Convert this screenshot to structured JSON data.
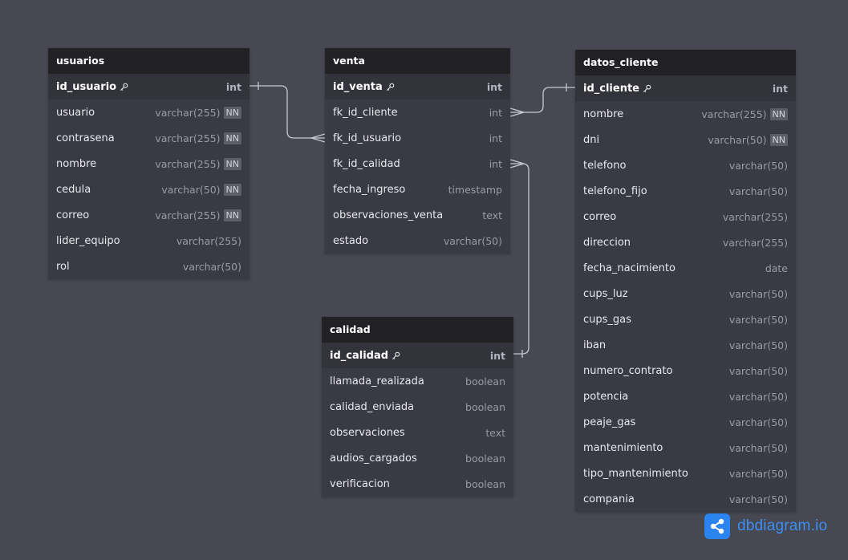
{
  "tables": {
    "usuarios": {
      "name": "usuarios",
      "fields": [
        {
          "name": "id_usuario",
          "type": "int",
          "pk": true,
          "nn": false
        },
        {
          "name": "usuario",
          "type": "varchar(255)",
          "pk": false,
          "nn": true
        },
        {
          "name": "contrasena",
          "type": "varchar(255)",
          "pk": false,
          "nn": true
        },
        {
          "name": "nombre",
          "type": "varchar(255)",
          "pk": false,
          "nn": true
        },
        {
          "name": "cedula",
          "type": "varchar(50)",
          "pk": false,
          "nn": true
        },
        {
          "name": "correo",
          "type": "varchar(255)",
          "pk": false,
          "nn": true
        },
        {
          "name": "lider_equipo",
          "type": "varchar(255)",
          "pk": false,
          "nn": false
        },
        {
          "name": "rol",
          "type": "varchar(50)",
          "pk": false,
          "nn": false
        }
      ]
    },
    "venta": {
      "name": "venta",
      "fields": [
        {
          "name": "id_venta",
          "type": "int",
          "pk": true,
          "nn": false
        },
        {
          "name": "fk_id_cliente",
          "type": "int",
          "pk": false,
          "nn": false
        },
        {
          "name": "fk_id_usuario",
          "type": "int",
          "pk": false,
          "nn": false
        },
        {
          "name": "fk_id_calidad",
          "type": "int",
          "pk": false,
          "nn": false
        },
        {
          "name": "fecha_ingreso",
          "type": "timestamp",
          "pk": false,
          "nn": false
        },
        {
          "name": "observaciones_venta",
          "type": "text",
          "pk": false,
          "nn": false
        },
        {
          "name": "estado",
          "type": "varchar(50)",
          "pk": false,
          "nn": false
        }
      ]
    },
    "calidad": {
      "name": "calidad",
      "fields": [
        {
          "name": "id_calidad",
          "type": "int",
          "pk": true,
          "nn": false
        },
        {
          "name": "llamada_realizada",
          "type": "boolean",
          "pk": false,
          "nn": false
        },
        {
          "name": "calidad_enviada",
          "type": "boolean",
          "pk": false,
          "nn": false
        },
        {
          "name": "observaciones",
          "type": "text",
          "pk": false,
          "nn": false
        },
        {
          "name": "audios_cargados",
          "type": "boolean",
          "pk": false,
          "nn": false
        },
        {
          "name": "verificacion",
          "type": "boolean",
          "pk": false,
          "nn": false
        }
      ]
    },
    "datos_cliente": {
      "name": "datos_cliente",
      "fields": [
        {
          "name": "id_cliente",
          "type": "int",
          "pk": true,
          "nn": false
        },
        {
          "name": "nombre",
          "type": "varchar(255)",
          "pk": false,
          "nn": true
        },
        {
          "name": "dni",
          "type": "varchar(50)",
          "pk": false,
          "nn": true
        },
        {
          "name": "telefono",
          "type": "varchar(50)",
          "pk": false,
          "nn": false
        },
        {
          "name": "telefono_fijo",
          "type": "varchar(50)",
          "pk": false,
          "nn": false
        },
        {
          "name": "correo",
          "type": "varchar(255)",
          "pk": false,
          "nn": false
        },
        {
          "name": "direccion",
          "type": "varchar(255)",
          "pk": false,
          "nn": false
        },
        {
          "name": "fecha_nacimiento",
          "type": "date",
          "pk": false,
          "nn": false
        },
        {
          "name": "cups_luz",
          "type": "varchar(50)",
          "pk": false,
          "nn": false
        },
        {
          "name": "cups_gas",
          "type": "varchar(50)",
          "pk": false,
          "nn": false
        },
        {
          "name": "iban",
          "type": "varchar(50)",
          "pk": false,
          "nn": false
        },
        {
          "name": "numero_contrato",
          "type": "varchar(50)",
          "pk": false,
          "nn": false
        },
        {
          "name": "potencia",
          "type": "varchar(50)",
          "pk": false,
          "nn": false
        },
        {
          "name": "peaje_gas",
          "type": "varchar(50)",
          "pk": false,
          "nn": false
        },
        {
          "name": "mantenimiento",
          "type": "varchar(50)",
          "pk": false,
          "nn": false
        },
        {
          "name": "tipo_mantenimiento",
          "type": "varchar(50)",
          "pk": false,
          "nn": false
        },
        {
          "name": "compania",
          "type": "varchar(50)",
          "pk": false,
          "nn": false
        }
      ]
    }
  },
  "nn_label": "NN",
  "relationships": [
    {
      "from_table": "usuarios",
      "from_field": "id_usuario",
      "to_table": "venta",
      "to_field": "fk_id_usuario",
      "cardinality": "one-to-many"
    },
    {
      "from_table": "datos_cliente",
      "from_field": "id_cliente",
      "to_table": "venta",
      "to_field": "fk_id_cliente",
      "cardinality": "one-to-many"
    },
    {
      "from_table": "calidad",
      "from_field": "id_calidad",
      "to_table": "venta",
      "to_field": "fk_id_calidad",
      "cardinality": "one-to-many"
    }
  ],
  "brand": {
    "text": "dbdiagram.io",
    "icon": "share-nodes-icon",
    "color": "#2b84f0"
  },
  "colors": {
    "background": "#484852",
    "header": "#222226",
    "table_body": "#3a3a44",
    "link": "#c8c8d0"
  }
}
